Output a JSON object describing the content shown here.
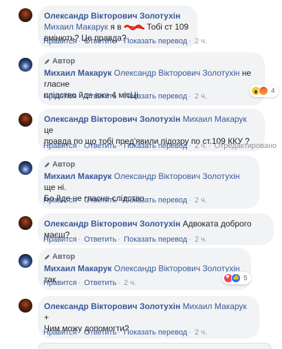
{
  "comments": [
    {
      "author": "Олександр Вікторович Золотухін",
      "author_is_page_author": false,
      "mention": "Михаил Макарук",
      "text_a": "я в",
      "text_b": "Тобі ст 109 вмінють? Це правда?",
      "actions": [
        "Нравится",
        "Ответить",
        "Показать перевод"
      ],
      "time": "2 ч."
    },
    {
      "badge": "Автор",
      "author": "Михаил Макарук",
      "mention": "Олександр Вікторович Золотухін",
      "text_a": "не гласне",
      "text_b": "слідство йде вже 4 місЦі",
      "actions": [
        "Нравится",
        "Ответить",
        "Показать перевод"
      ],
      "time": "2 ч.",
      "reactions": {
        "icons": [
          "wow-icon",
          "angry-icon"
        ],
        "count": "4"
      }
    },
    {
      "author": "Олександр Вікторович Золотухін",
      "mention": "Михаил Макарук",
      "text_a": "це",
      "text_b": "правда по що тобі пред'явили підозру по ст.109 ККУ ?",
      "actions": [
        "Нравится",
        "Ответить",
        "Показать перевод"
      ],
      "time": "2 ч.",
      "edited": "Отредактировано"
    },
    {
      "badge": "Автор",
      "author": "Михаил Макарук",
      "mention": "Олександр Вікторович Золотухін",
      "text_a": "ще ні.",
      "text_b": "Бо йде не гласне слідство",
      "actions": [
        "Нравится",
        "Ответить",
        "Показать перевод"
      ],
      "time": "2 ч."
    },
    {
      "author": "Олександр Вікторович Золотухін",
      "text_a": "Адвоката доброго маєш?",
      "actions": [
        "Нравится",
        "Ответить",
        "Показать перевод"
      ],
      "time": "2 ч."
    },
    {
      "badge": "Автор",
      "author": "Михаил Макарук",
      "mention": "Олександр Вікторович Золотухін",
      "text_a": "так",
      "actions": [
        "Нравится",
        "Ответить"
      ],
      "time": "2 ч.",
      "reactions": {
        "icons": [
          "love-icon",
          "like-icon"
        ],
        "count": "5"
      }
    },
    {
      "author": "Олександр Вікторович Золотухін",
      "mention": "Михаил Макарук",
      "text_a": "+",
      "text_b": "Чим можу допомогти?",
      "actions": [
        "Нравится",
        "Ответить",
        "Показать перевод"
      ],
      "time": "2 ч."
    }
  ],
  "colors": {
    "link": "#385898",
    "bubble": "#f2f3f5",
    "meta": "#606770"
  }
}
